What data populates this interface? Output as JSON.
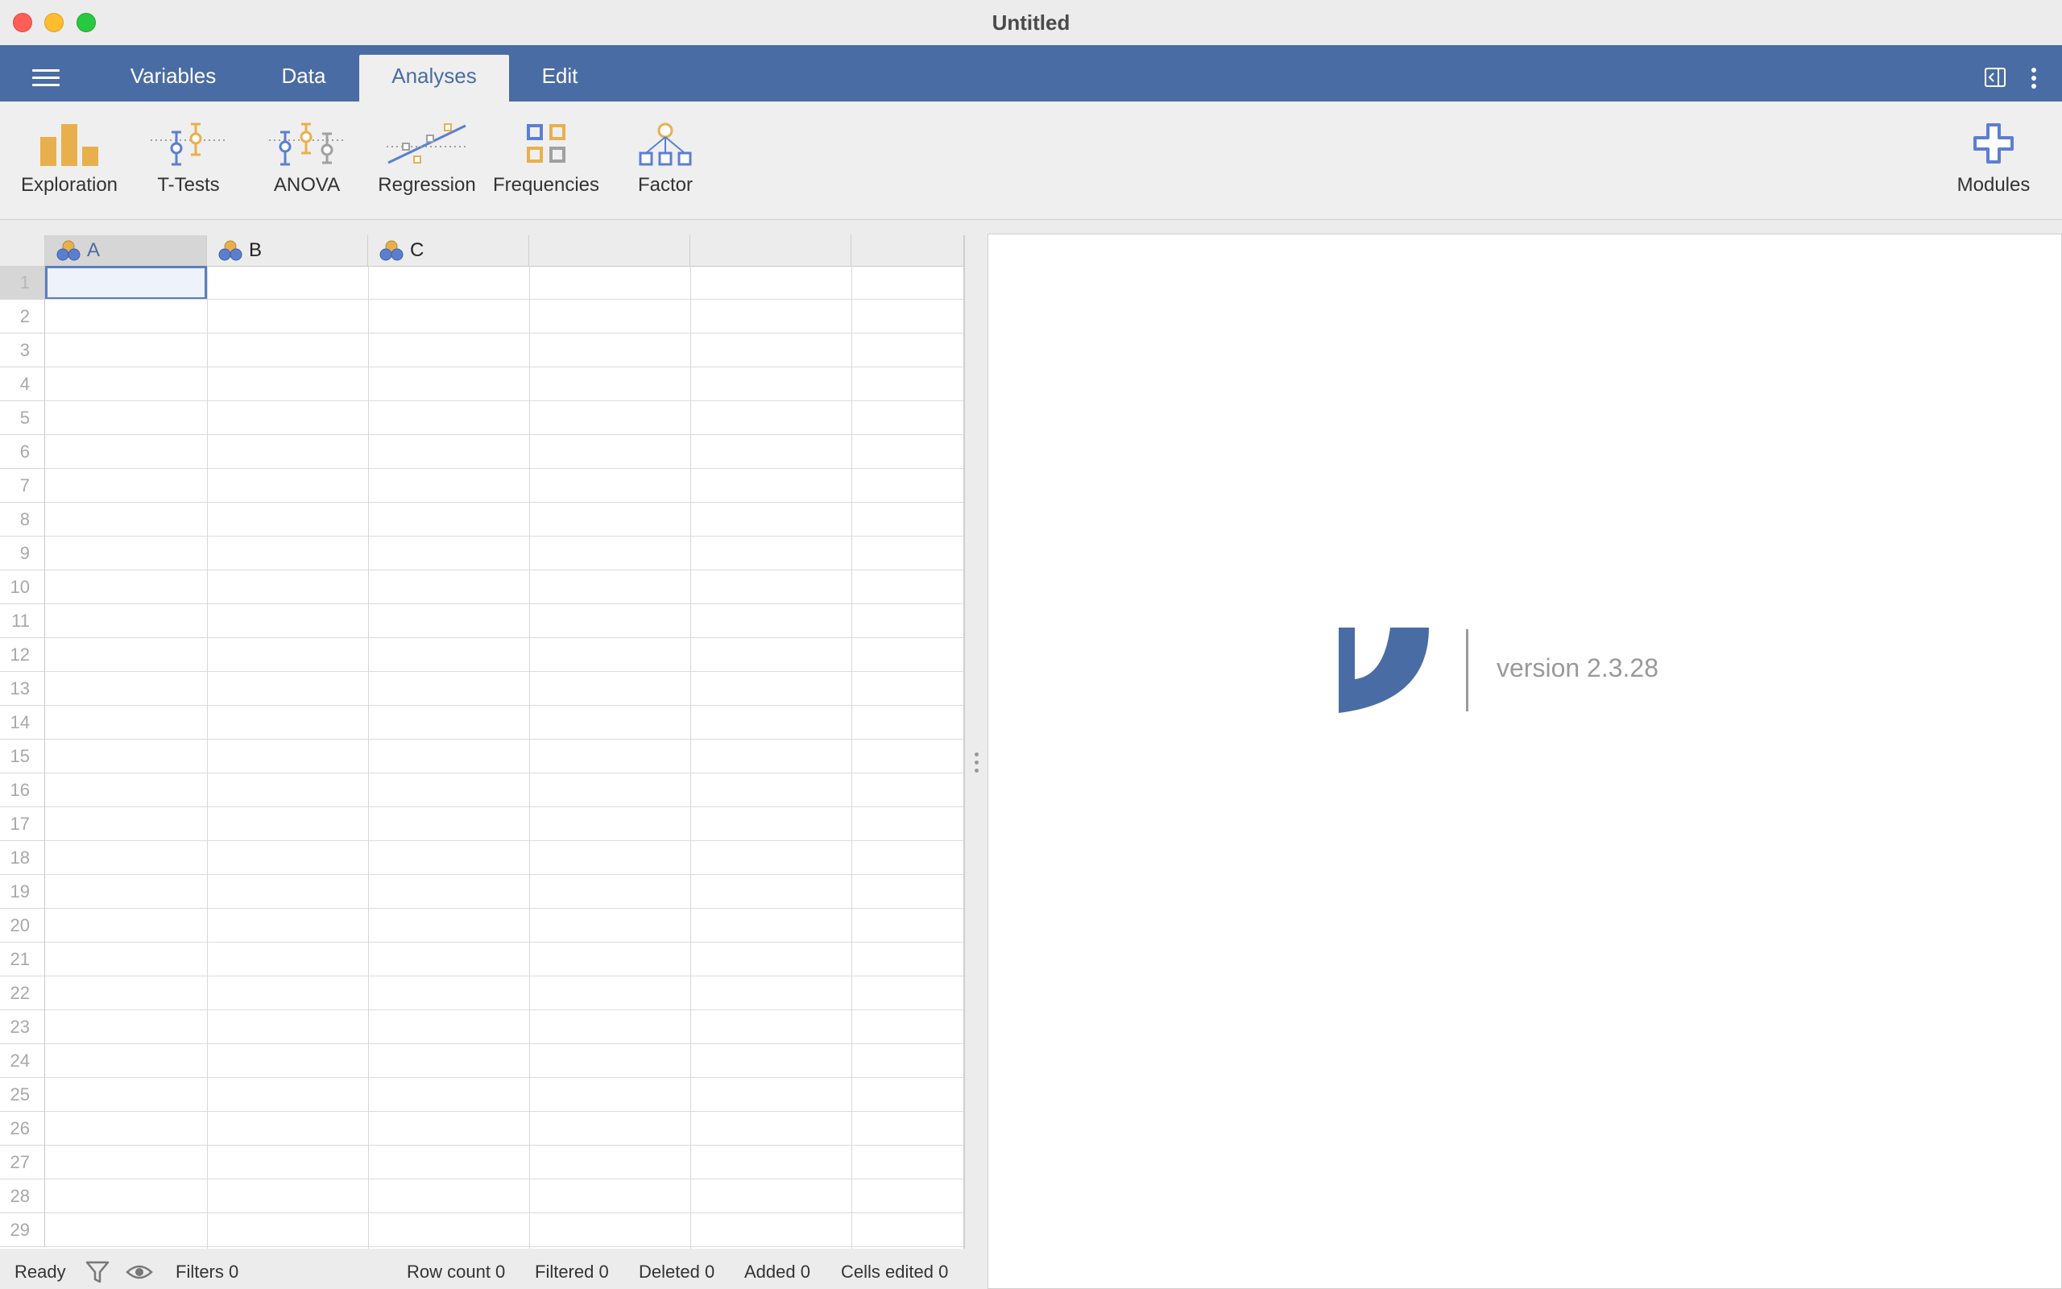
{
  "window": {
    "title": "Untitled"
  },
  "ribbon": {
    "tabs": [
      {
        "label": "Variables"
      },
      {
        "label": "Data"
      },
      {
        "label": "Analyses",
        "active": true
      },
      {
        "label": "Edit"
      }
    ]
  },
  "toolbar": {
    "items": [
      {
        "label": "Exploration",
        "icon": "bar-chart-icon"
      },
      {
        "label": "T-Tests",
        "icon": "t-test-icon"
      },
      {
        "label": "ANOVA",
        "icon": "anova-icon"
      },
      {
        "label": "Regression",
        "icon": "regression-icon"
      },
      {
        "label": "Frequencies",
        "icon": "frequencies-icon"
      },
      {
        "label": "Factor",
        "icon": "factor-icon"
      }
    ],
    "modules_label": "Modules"
  },
  "spreadsheet": {
    "columns": [
      {
        "name": "A",
        "selected": true
      },
      {
        "name": "B"
      },
      {
        "name": "C"
      }
    ],
    "rows": [
      "1",
      "2",
      "3",
      "4",
      "5",
      "6",
      "7",
      "8",
      "9",
      "10",
      "11",
      "12",
      "13",
      "14",
      "15",
      "16",
      "17",
      "18",
      "19",
      "20",
      "21",
      "22",
      "23",
      "24",
      "25",
      "26",
      "27",
      "28",
      "29"
    ],
    "selected_cell": "A1"
  },
  "status": {
    "ready": "Ready",
    "filters": "Filters 0",
    "row_count": "Row count 0",
    "filtered": "Filtered 0",
    "deleted": "Deleted 0",
    "added": "Added 0",
    "cells_edited": "Cells edited 0"
  },
  "results": {
    "version": "version 2.3.28"
  },
  "colors": {
    "accent": "#4a6ca4",
    "orange": "#e8b04c",
    "blue_icon": "#5b7fd0",
    "grey_icon": "#a0a0a0"
  }
}
